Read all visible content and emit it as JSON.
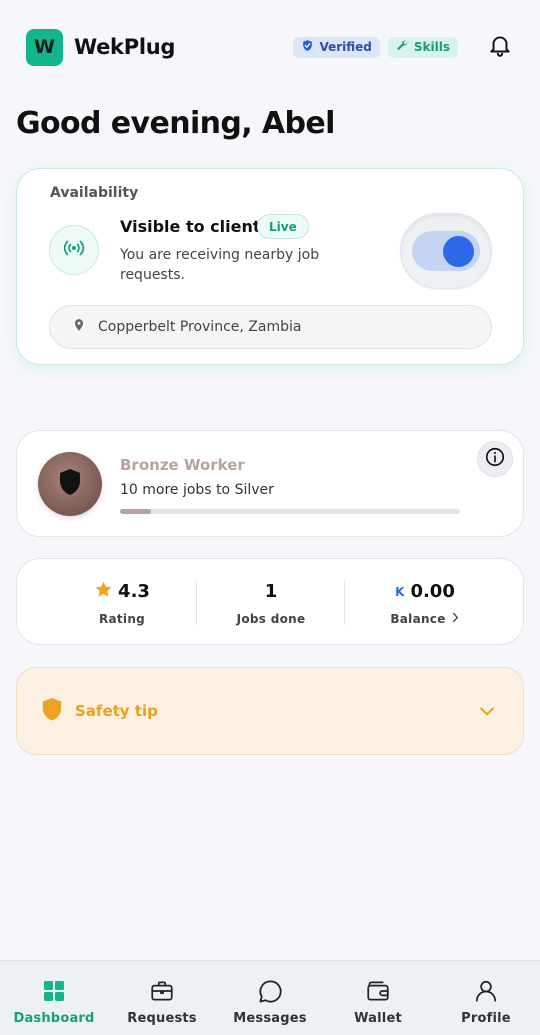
{
  "header": {
    "logo_letter": "W",
    "brand": "WekPlug",
    "verified_label": "Verified",
    "skills_label": "Skills",
    "icons": {
      "bell": "bell-icon",
      "verified": "shield-check-icon",
      "skills": "wrench-icon"
    }
  },
  "greeting": "Good evening, Abel",
  "availability": {
    "section_label": "Availability",
    "title": "Visible to clients",
    "live_label": "Live",
    "description": "You are receiving nearby job requests.",
    "toggle_on": true,
    "location": "Copperbelt Province, Zambia"
  },
  "tier": {
    "name": "Bronze Worker",
    "subtitle": "10 more jobs to Silver",
    "progress": 0.09
  },
  "stats": {
    "rating_value": "4.3",
    "rating_label": "Rating",
    "jobs_value": "1",
    "jobs_label": "Jobs done",
    "balance_currency": "K",
    "balance_value": "0.00",
    "balance_label": "Balance"
  },
  "safety": {
    "label": "Safety tip"
  },
  "nav": {
    "items": [
      {
        "label": "Dashboard",
        "icon": "grid-icon",
        "active": true
      },
      {
        "label": "Requests",
        "icon": "briefcase-icon",
        "active": false
      },
      {
        "label": "Messages",
        "icon": "chat-bubble-icon",
        "active": false
      },
      {
        "label": "Wallet",
        "icon": "wallet-icon",
        "active": false
      },
      {
        "label": "Profile",
        "icon": "user-icon",
        "active": false
      }
    ]
  },
  "colors": {
    "accent": "#13b58d",
    "toggle_blue": "#2d68e6",
    "bronze": "#b8a39d",
    "safety_amber": "#e8a21d",
    "star": "#f2a419"
  }
}
